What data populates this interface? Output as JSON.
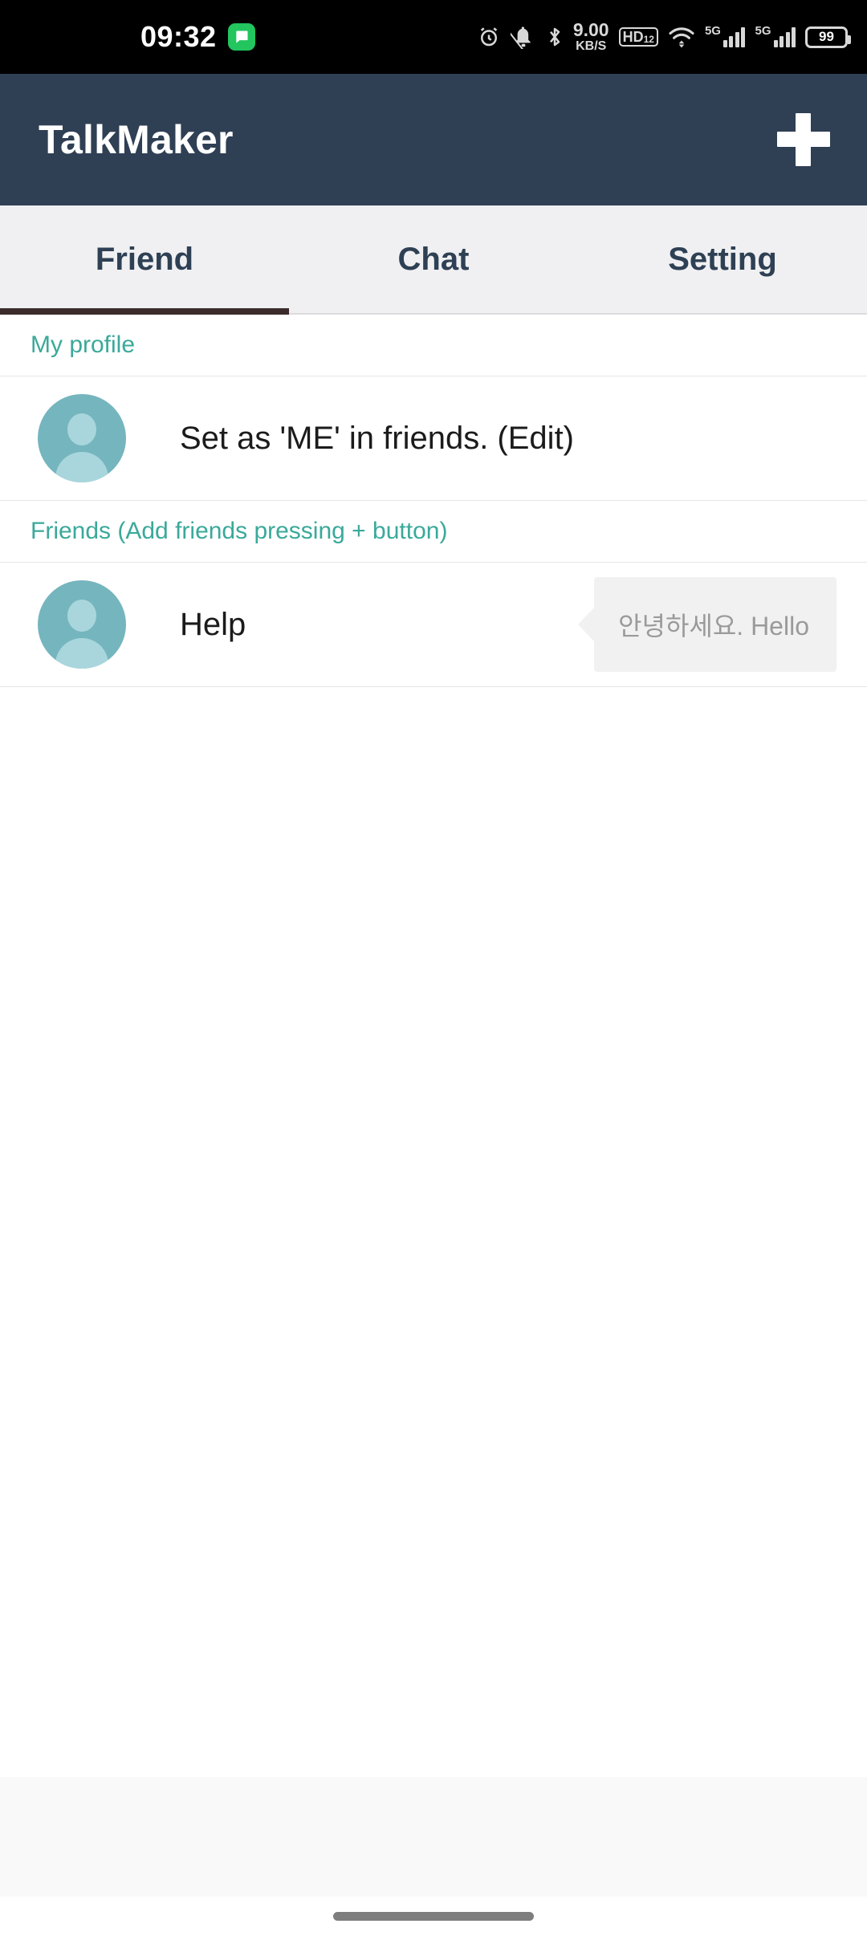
{
  "status_bar": {
    "time": "09:32",
    "message_icon": "chat-bubble-icon",
    "icons": [
      {
        "name": "alarm-clock-icon",
        "label": ""
      },
      {
        "name": "mute-bell-icon",
        "label": ""
      },
      {
        "name": "bluetooth-icon",
        "label": ""
      }
    ],
    "network_speed": {
      "value": "9.00",
      "unit": "KB/S"
    },
    "hd_badge": {
      "text": "HD",
      "sup": "1",
      "sub": "2"
    },
    "wifi_icon": "wifi-icon",
    "sim1": {
      "label": "5G",
      "bars": 4
    },
    "sim2": {
      "label": "5G",
      "bars": 4
    },
    "battery": {
      "percent": "99"
    }
  },
  "app_bar": {
    "title": "TalkMaker",
    "add_button_label": "+",
    "background": "#2f3f54"
  },
  "tabs": {
    "items": [
      {
        "id": "friend",
        "label": "Friend",
        "active": true
      },
      {
        "id": "chat",
        "label": "Chat",
        "active": false
      },
      {
        "id": "setting",
        "label": "Setting",
        "active": false
      }
    ],
    "indicator_color": "#3b2b2b",
    "background": "#f0f0f2",
    "text_color": "#2e4054"
  },
  "sections": [
    {
      "id": "my-profile",
      "header": "My profile",
      "header_color": "#3aa99a",
      "rows": [
        {
          "id": "my-profile-row",
          "avatar": "person-avatar-icon",
          "name": "Set as 'ME' in friends. (Edit)",
          "bubble": null
        }
      ]
    },
    {
      "id": "friends",
      "header": "Friends (Add friends pressing + button)",
      "header_color": "#3aa99a",
      "rows": [
        {
          "id": "friend-help",
          "avatar": "person-avatar-icon",
          "name": "Help",
          "bubble": "안녕하세요. Hello"
        }
      ]
    }
  ],
  "bottom": {
    "band_color": "#f9f9f9",
    "home_indicator": "home-indicator-pill"
  },
  "colors": {
    "accent_teal": "#3aa99a",
    "avatar": "#75b5be",
    "avatar_glyph": "#a9d6dd",
    "bubble_bg": "#f1f1f1",
    "bubble_text": "#9a9a9a"
  }
}
